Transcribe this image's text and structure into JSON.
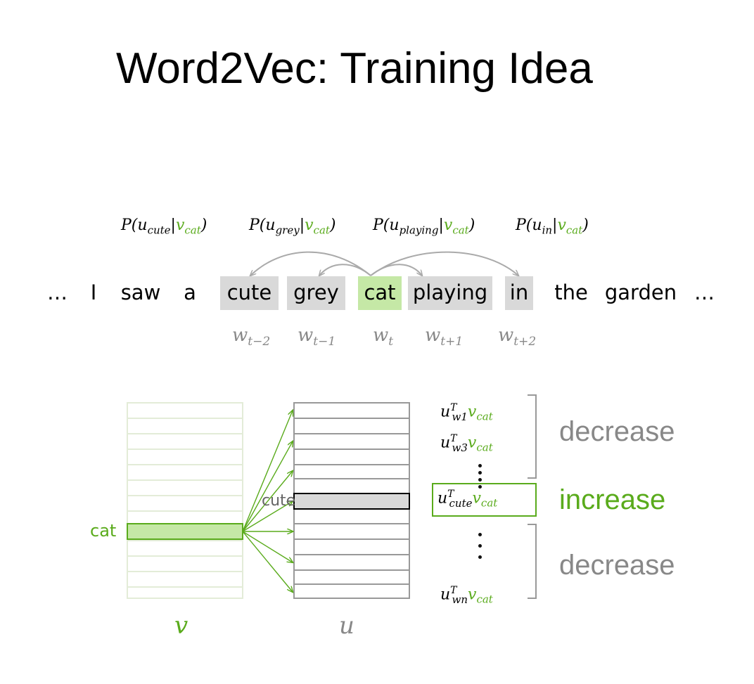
{
  "title": "Word2Vec: Training Idea",
  "colors": {
    "accent": "#5aab1c",
    "accent_fill": "#c5e8a6",
    "word_box": "#d9d9d9",
    "gray": "#888888",
    "pale_grid": "#e3ecd8"
  },
  "probabilities": [
    {
      "P": "P(",
      "u_base": "u",
      "u_sub": "cute",
      "bar": "|",
      "v_base": "v",
      "v_sub": "cat",
      "close": ")"
    },
    {
      "P": "P(",
      "u_base": "u",
      "u_sub": "grey",
      "bar": "|",
      "v_base": "v",
      "v_sub": "cat",
      "close": ")"
    },
    {
      "P": "P(",
      "u_base": "u",
      "u_sub": "playing",
      "bar": "|",
      "v_base": "v",
      "v_sub": "cat",
      "close": ")"
    },
    {
      "P": "P(",
      "u_base": "u",
      "u_sub": "in",
      "bar": "|",
      "v_base": "v",
      "v_sub": "cat",
      "close": ")"
    }
  ],
  "sentence": {
    "lead_ellipsis": "…",
    "words": [
      "I",
      "saw",
      "a",
      "cute",
      "grey",
      "cat",
      "playing",
      "in",
      "the",
      "garden"
    ],
    "trail_ellipsis": "…"
  },
  "word_labels": [
    {
      "base": "w",
      "sub": "t−2"
    },
    {
      "base": "w",
      "sub": "t−1"
    },
    {
      "base": "w",
      "sub": "t"
    },
    {
      "base": "w",
      "sub": "t+1"
    },
    {
      "base": "w",
      "sub": "t+2"
    }
  ],
  "matrix_v": {
    "row_label": "cat",
    "name": "v"
  },
  "matrix_u": {
    "row_label": "cute",
    "name": "u"
  },
  "scores": {
    "top": [
      {
        "u": "u",
        "sup": "T",
        "sub": "w1",
        "v": "v",
        "vsub": "cat"
      },
      {
        "u": "u",
        "sup": "T",
        "sub": "w3",
        "v": "v",
        "vsub": "cat"
      }
    ],
    "middle": {
      "u": "u",
      "sup": "T",
      "sub": "cute",
      "v": "v",
      "vsub": "cat"
    },
    "bottom": {
      "u": "u",
      "sup": "T",
      "sub": "wn",
      "v": "v",
      "vsub": "cat"
    }
  },
  "labels": {
    "decrease_top": "decrease",
    "increase": "increase",
    "decrease_bottom": "decrease"
  }
}
